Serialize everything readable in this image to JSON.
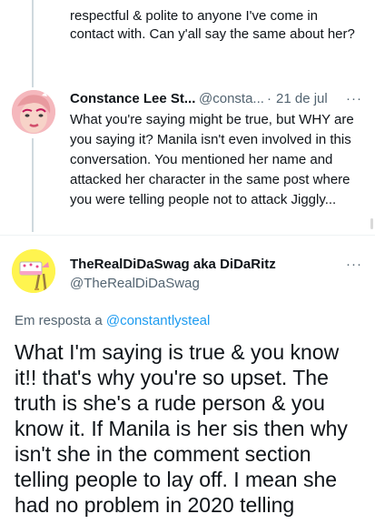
{
  "previous_tweet": {
    "lines": [
      "respectful & polite to anyone I've come in",
      "contact with. Can y'all say the same about her?"
    ]
  },
  "reply_tweet": {
    "display_name": "Constance Lee St...",
    "handle": "@consta...",
    "separator": "·",
    "date": "21 de jul",
    "more": "···",
    "lines": [
      "What you're saying might be true, but WHY are",
      "you saying it? Manila isn't even involved in this",
      "conversation. You mentioned her name and",
      "attacked her character in the same post where",
      "you were telling people not to attack Jiggly..."
    ]
  },
  "main_tweet": {
    "display_name": "TheRealDiDaSwag aka DiDaRitz",
    "handle": "@TheRealDiDaSwag",
    "more": "···",
    "reply_prefix": "Em resposta a",
    "reply_handle": "@constantlysteal",
    "lines": [
      "What I'm saying is true & you know",
      "it!! that's why you're so upset. The",
      "truth is she's a rude person & you",
      "know it. If Manila is her sis then why",
      "isn't she in the comment section",
      "telling people to lay off. I mean she",
      "had no problem in 2020 telling"
    ]
  },
  "colors": {
    "text": "#0f1419",
    "secondary": "#536471",
    "link": "#1d9bf0",
    "thread_line": "#cfd9de"
  }
}
